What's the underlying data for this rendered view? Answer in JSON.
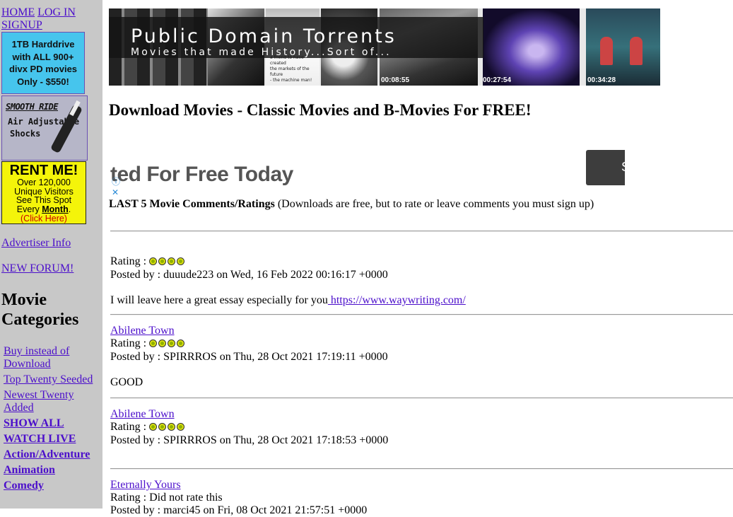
{
  "nav": {
    "home": "HOME",
    "login": "LOG IN",
    "signup": "SIGNUP"
  },
  "ads": {
    "harddrive": [
      "1TB Harddrive",
      "with ALL 900+",
      "divx PD movies",
      "Only - $550!"
    ],
    "shocks": {
      "line1": "SMOOTH RIDE",
      "line2": "Air Adjustable",
      "line3": "Shocks"
    },
    "rentme": {
      "title": "RENT ME!",
      "line1": "Over 120,000",
      "line2": "Unique Visitors",
      "line3": "See This Spot",
      "line4_prefix": "Every",
      "line4_bold": "Month",
      "line4_suffix": ".",
      "click": "(Click Here)"
    }
  },
  "sidebar": {
    "advertiser_info": "Advertiser Info",
    "new_forum": "NEW FORUM!",
    "categories_title_1": "Movie",
    "categories_title_2": "Categories",
    "categories": [
      {
        "label": "Buy instead of Download",
        "bold": false
      },
      {
        "label": "Top Twenty Seeded",
        "bold": false
      },
      {
        "label": "Newest Twenty Added",
        "bold": false
      },
      {
        "label": "SHOW ALL",
        "bold": true
      },
      {
        "label": "WATCH LIVE",
        "bold": true
      },
      {
        "label": "Action/Adventure",
        "bold": true
      },
      {
        "label": "Animation",
        "bold": true
      },
      {
        "label": "Comedy",
        "bold": true
      }
    ]
  },
  "banner": {
    "title": "Public Domain Torrents",
    "subtitle": "Movies that made History...Sort of...",
    "timestamps": [
      "00:08:55",
      "00:27:54",
      "00:34:28"
    ],
    "frame_captions": [
      "a friend to have created",
      "the markets of the future",
      "- the machine man!"
    ]
  },
  "headline": "Download Movies - Classic Movies and B-Movies For FREE!",
  "ad_banner": {
    "text": "ted For Free Today",
    "button_text": "S"
  },
  "comments_section": {
    "title": "LAST 5 Movie Comments/Ratings",
    "note": "(Downloads are free, but to rate or leave comments you must sign up)"
  },
  "comments": [
    {
      "movie": "",
      "rating_label": "Rating :",
      "stars": 4,
      "posted": "Posted by : duuude223 on Wed, 16 Feb 2022 00:16:17 +0000",
      "body": "I will leave here a great essay especially for you",
      "link": " https://www.waywriting.com/"
    },
    {
      "movie": "Abilene Town",
      "rating_label": "Rating :",
      "stars": 4,
      "posted": "Posted by : SPIRRROS on Thu, 28 Oct 2021 17:19:11 +0000",
      "body": "GOOD"
    },
    {
      "movie": "Abilene Town",
      "rating_label": "Rating :",
      "stars": 4,
      "posted": "Posted by : SPIRRROS on Thu, 28 Oct 2021 17:18:53 +0000",
      "body": ""
    },
    {
      "movie": "Eternally Yours",
      "rating_label": "Rating : Did not rate this",
      "stars": 0,
      "posted": "Posted by : marci45 on Fri, 08 Oct 2021 21:57:51 +0000"
    }
  ]
}
